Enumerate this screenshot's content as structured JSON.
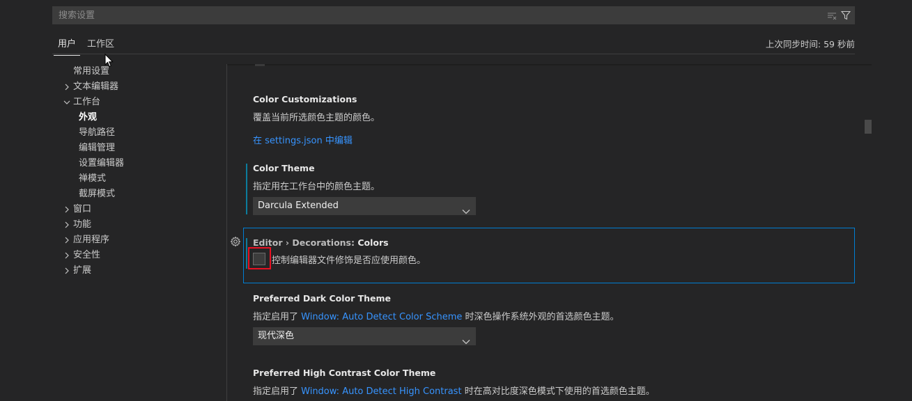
{
  "search": {
    "placeholder": "搜索设置",
    "value": "",
    "clear_icon": "clear-filter-icon",
    "filter_icon": "filter-icon"
  },
  "tabs": [
    {
      "label": "用户",
      "active": true
    },
    {
      "label": "工作区",
      "active": false
    }
  ],
  "sync_status": "上次同步时间: 59 秒前",
  "toc": [
    {
      "label": "常用设置",
      "level": 0,
      "expandable": false
    },
    {
      "label": "文本编辑器",
      "level": 0,
      "expandable": true,
      "expanded": false
    },
    {
      "label": "工作台",
      "level": 0,
      "expandable": true,
      "expanded": true
    },
    {
      "label": "外观",
      "level": 1,
      "selected": true
    },
    {
      "label": "导航路径",
      "level": 1
    },
    {
      "label": "编辑管理",
      "level": 1
    },
    {
      "label": "设置编辑器",
      "level": 1
    },
    {
      "label": "禅模式",
      "level": 1
    },
    {
      "label": "截屏模式",
      "level": 1
    },
    {
      "label": "窗口",
      "level": 0,
      "expandable": true,
      "expanded": false
    },
    {
      "label": "功能",
      "level": 0,
      "expandable": true,
      "expanded": false
    },
    {
      "label": "应用程序",
      "level": 0,
      "expandable": true,
      "expanded": false
    },
    {
      "label": "安全性",
      "level": 0,
      "expandable": true,
      "expanded": false
    },
    {
      "label": "扩展",
      "level": 0,
      "expandable": true,
      "expanded": false
    }
  ],
  "settings": {
    "color_customizations": {
      "title": "Color Customizations",
      "description": "覆盖当前所选颜色主题的颜色。",
      "link": "在 settings.json 中编辑"
    },
    "color_theme": {
      "title": "Color Theme",
      "description": "指定用在工作台中的颜色主题。",
      "value": "Darcula Extended",
      "modified": true
    },
    "decorations_colors": {
      "category": "Editor › Decorations: ",
      "title": "Colors",
      "description": "控制编辑器文件修饰是否应使用颜色。",
      "checked": false
    },
    "preferred_dark": {
      "title": "Preferred Dark Color Theme",
      "desc_prefix": "指定启用了 ",
      "desc_link": "Window: Auto Detect Color Scheme",
      "desc_suffix": " 时深色操作系统外观的首选颜色主题。",
      "value": "现代深色"
    },
    "preferred_hc": {
      "title": "Preferred High Contrast Color Theme",
      "desc_prefix": "指定启用了 ",
      "desc_link": "Window: Auto Detect High Contrast",
      "desc_suffix": " 时在高对比度深色模式下使用的首选颜色主题。"
    }
  },
  "colors": {
    "background": "#252526",
    "accent_link": "#3794ff",
    "focus_border": "#007fd4",
    "modified_indicator": "#0c7d9d",
    "highlight_red": "#e81123"
  }
}
